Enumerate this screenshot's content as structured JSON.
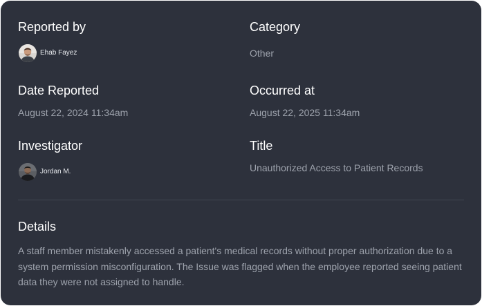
{
  "fields": {
    "reported_by": {
      "label": "Reported by",
      "name": "Ehab Fayez",
      "avatar_icon": "user-avatar-photo"
    },
    "category": {
      "label": "Category",
      "value": "Other"
    },
    "date_reported": {
      "label": "Date Reported",
      "value": "August 22, 2024 11:34am"
    },
    "occurred_at": {
      "label": "Occurred at",
      "value": "August 22, 2025 11:34am"
    },
    "investigator": {
      "label": "Investigator",
      "name": "Jordan M.",
      "avatar_icon": "user-avatar-photo"
    },
    "title": {
      "label": "Title",
      "value": "Unauthorized Access to Patient Records"
    }
  },
  "details": {
    "label": "Details",
    "text": "A staff member mistakenly accessed a patient's medical records without proper authorization due to a system permission misconfiguration. The Issue was flagged when the employee reported seeing patient data they were not assigned to handle."
  },
  "colors": {
    "card_background": "#2d313c",
    "label_text": "#ffffff",
    "value_text": "#9ea3ad",
    "divider": "#414652"
  }
}
